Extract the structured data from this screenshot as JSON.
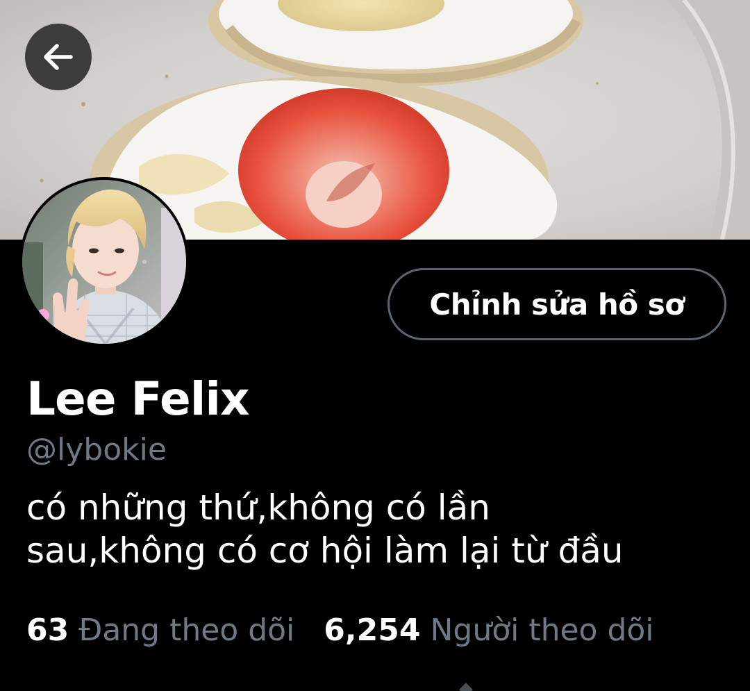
{
  "header": {
    "back_icon": "arrow-left-icon",
    "banner_image": "food-photo-rice-cakes-strawberry"
  },
  "profile": {
    "avatar_image": "profile-photo",
    "edit_button_label": "Chỉnh sửa hồ sơ",
    "display_name": "Lee Felix",
    "handle": "@lybokie",
    "bio_lines": [
      "có những thứ,không có lần",
      "sau,không có cơ hội làm lại từ đầu"
    ]
  },
  "stats": {
    "following": {
      "value": "63",
      "label": "Đang theo dõi"
    },
    "followers": {
      "value": "6,254",
      "label": "Người theo dõi"
    }
  },
  "colors": {
    "background": "#000000",
    "text_primary": "#ffffff",
    "text_secondary": "#6e7a85",
    "button_border": "#5b6570",
    "back_button_bg": "#303030"
  }
}
